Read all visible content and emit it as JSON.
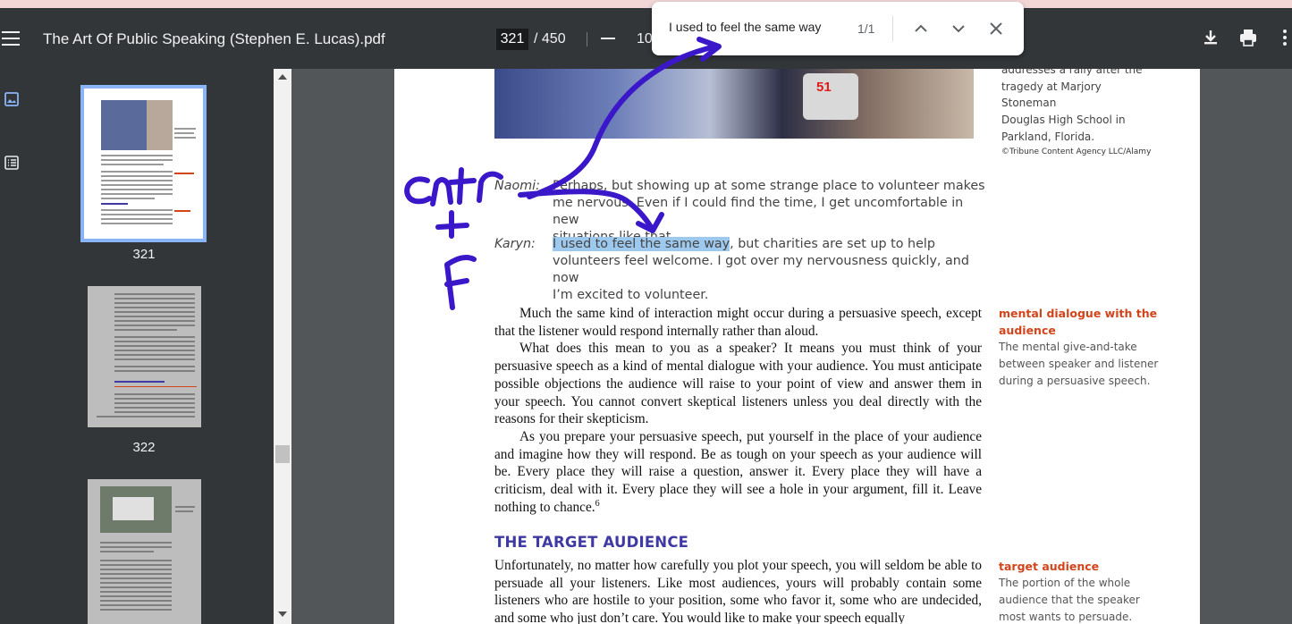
{
  "toolbar": {
    "title": "The Art Of Public Speaking (Stephen E. Lucas).pdf",
    "current_page": "321",
    "total_pages": "/ 450",
    "zoom": "10"
  },
  "find": {
    "query": "I used to feel the same way",
    "count": "1/1"
  },
  "thumbnails": [
    {
      "label": "321",
      "selected": true
    },
    {
      "label": "322",
      "selected": false
    }
  ],
  "page": {
    "caption_lines": [
      "addresses a rally after the",
      "tragedy at Marjory Stoneman",
      "Douglas High School in",
      "Parkland, Florida."
    ],
    "photo_credit": "©Tribune Content Agency LLC/Alamy",
    "photo_mic_label": "51",
    "dialogue": [
      {
        "speaker": "Naomi:",
        "lines": [
          "Perhaps, but showing up at some strange place to volunteer makes",
          "me nervous. Even if I could find the time, I get uncomfortable in new",
          "situations like that."
        ]
      },
      {
        "speaker": "Karyn:",
        "highlight": "I used to feel the same way",
        "rest": ", but charities are set up to help",
        "lines": [
          "volunteers feel welcome. I got over my nervousness quickly, and now",
          "I’m excited to volunteer."
        ]
      }
    ],
    "paragraphs": [
      "Much the same kind of interaction might occur during a persuasive speech, except that the listener would respond internally rather than aloud.",
      "What does this mean to you as a speaker? It means you must think of your persuasive speech as a kind of mental dialogue with your audience. You must anticipate possible objections the audience will raise to your point of view and answer them in your speech. You cannot convert skeptical listeners unless you deal directly with the reasons for their skepticism.",
      "As you prepare your persuasive speech, put yourself in the place of your audience and imagine how they will respond. Be as tough on your speech as your audience will be. Every place they will raise a question, answer it. Every place they will have a criticism, deal with it. Every place they will see a hole in your argument, fill it. Leave nothing to chance."
    ],
    "footnote_mark": "6",
    "section_heading": "THE TARGET AUDIENCE",
    "section_paragraph": "Unfortunately, no matter how carefully you plot your speech, you will seldom be able to persuade all your listeners. Like most audiences, yours will probably contain some listeners who are hostile to your position, some who favor it, some who are undecided, and some who just don’t care. You would like to make your speech equally",
    "glossary": [
      {
        "term": "mental dialogue with the audience",
        "definition": "The mental give-and-take between speaker and listener during a persuasive speech."
      },
      {
        "term": "target audience",
        "definition": "The portion of the whole audience that the speaker most wants to persuade."
      }
    ]
  },
  "colors": {
    "toolbar_bg": "#323639",
    "viewer_bg": "#525659",
    "highlight": "#9ec9ef",
    "glossary_term": "#d2451b",
    "heading": "#3f3aa3",
    "annotation_ink": "#3a17c9"
  }
}
